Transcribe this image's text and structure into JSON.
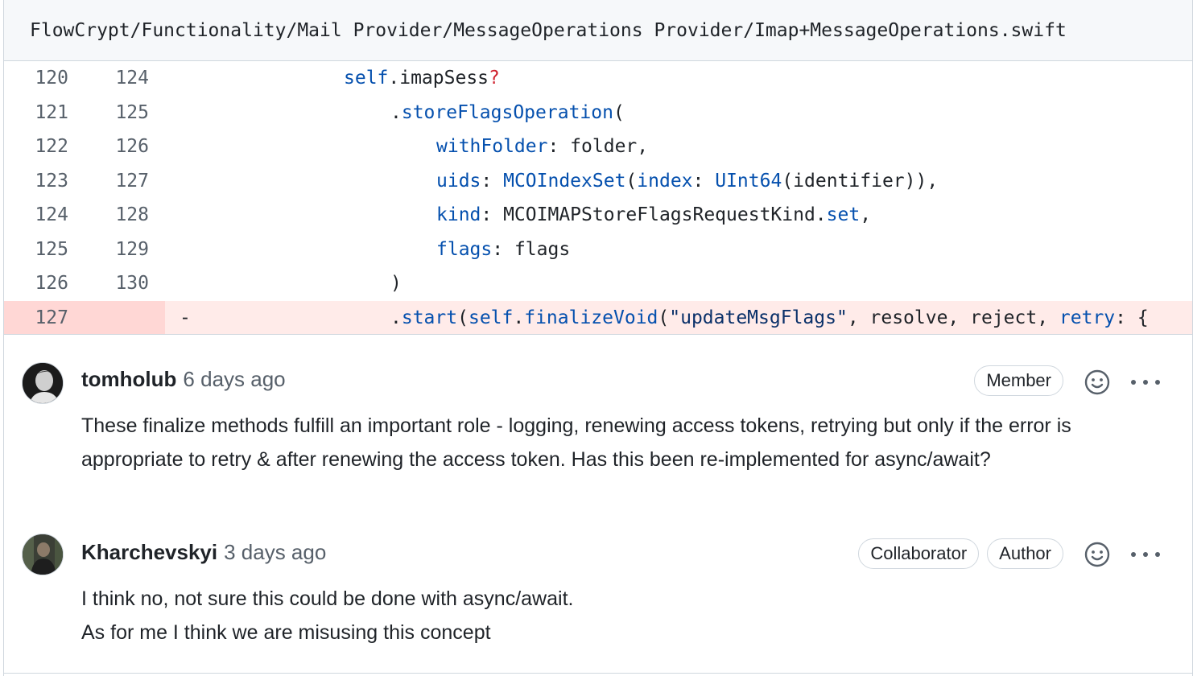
{
  "file": {
    "path": "FlowCrypt/Functionality/Mail Provider/MessageOperations Provider/Imap+MessageOperations.swift"
  },
  "diff": {
    "rows": [
      {
        "old": "120",
        "new": "124",
        "type": "context"
      },
      {
        "old": "121",
        "new": "125",
        "type": "context"
      },
      {
        "old": "122",
        "new": "126",
        "type": "context"
      },
      {
        "old": "123",
        "new": "127",
        "type": "context"
      },
      {
        "old": "124",
        "new": "128",
        "type": "context"
      },
      {
        "old": "125",
        "new": "129",
        "type": "context"
      },
      {
        "old": "126",
        "new": "130",
        "type": "context"
      },
      {
        "old": "127",
        "new": "",
        "type": "deletion",
        "marker": "-"
      }
    ],
    "code": {
      "l1": {
        "self": "self",
        "rest": ".imapSess",
        "q": "?"
      },
      "l2": {
        "dot": ".",
        "fn": "storeFlagsOperation",
        "paren": "("
      },
      "l3": {
        "label": "withFolder",
        "rest": ": folder,"
      },
      "l4": {
        "label": "uids",
        "colon": ": ",
        "type": "MCOIndexSet",
        "p1": "(",
        "label2": "index",
        "colon2": ": ",
        "type2": "UInt64",
        "rest": "(identifier)),"
      },
      "l5": {
        "label": "kind",
        "rest": ": MCOIMAPStoreFlagsRequestKind.",
        "member": "set",
        "comma": ","
      },
      "l6": {
        "label": "flags",
        "rest": ": flags"
      },
      "l7": {
        "paren": ")"
      },
      "l8": {
        "dot": ".",
        "fn": "start",
        "p1": "(",
        "self": "self",
        "dot2": ".",
        "fn2": "finalizeVoid",
        "p2": "(",
        "str": "\"updateMsgFlags\"",
        "rest": ", resolve, reject, ",
        "label": "retry",
        "tail": ": {"
      }
    }
  },
  "comments": [
    {
      "author": "tomholub",
      "time": "6 days ago",
      "badges": [
        "Member"
      ],
      "body": "These finalize methods fulfill an important role - logging, renewing access tokens, retrying but only if the error is appropriate to retry & after renewing the access token. Has this been re-implemented for async/await?"
    },
    {
      "author": "Kharchevskyi",
      "time": "3 days ago",
      "badges": [
        "Collaborator",
        "Author"
      ],
      "body_line1": "I think no, not sure this could be done with async/await.",
      "body_line2": "As for me I think we are misusing this concept"
    }
  ],
  "icons": {
    "reaction": "smiley-icon",
    "more": "kebab-horizontal-icon"
  },
  "colors": {
    "deletion_bg": "#ffebe9",
    "deletion_gutter": "#ffd7d5",
    "keyword": "#0550ae",
    "string": "#0a3069",
    "optional": "#cf222e"
  }
}
